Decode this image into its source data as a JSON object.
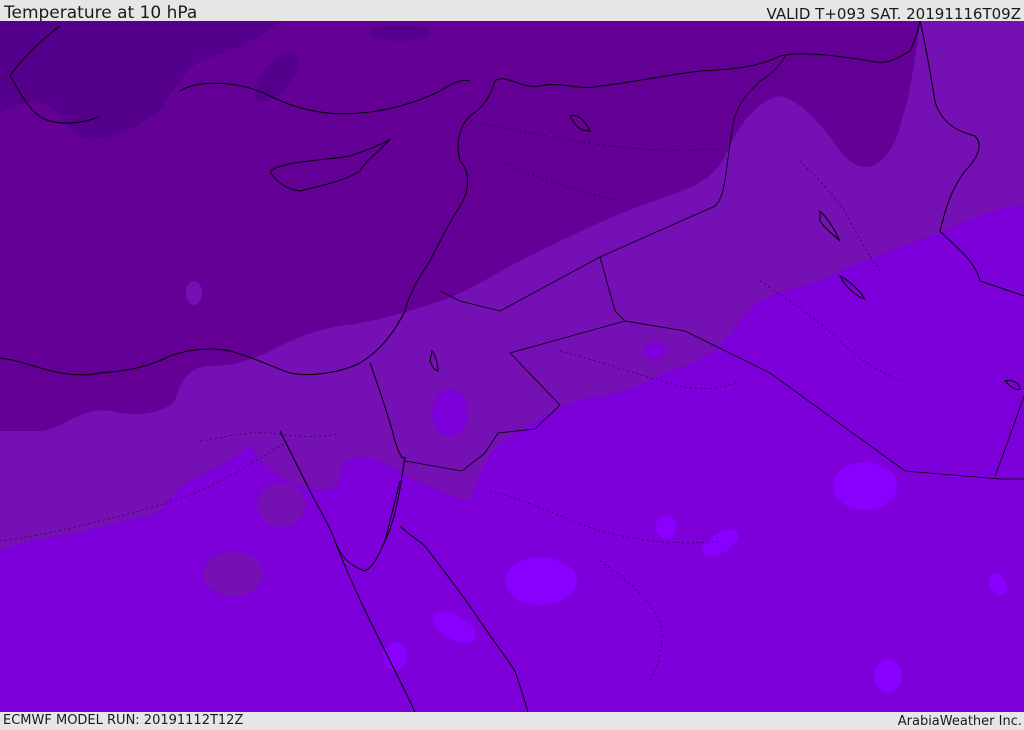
{
  "header": {
    "title": "Temperature at 10 hPa",
    "valid": "VALID T+093 SAT. 20191116T09Z"
  },
  "footer": {
    "model_run": "ECMWF MODEL RUN: 20191112T12Z",
    "credit": "ArabiaWeather Inc."
  },
  "colors": {
    "band_coldest": "#55008c",
    "band_cold": "#650096",
    "band_mid": "#7410b4",
    "band_warm": "#7d00da",
    "band_warmest": "#8a00ff",
    "coastline": "#000000",
    "background": "#e6e6e6"
  }
}
